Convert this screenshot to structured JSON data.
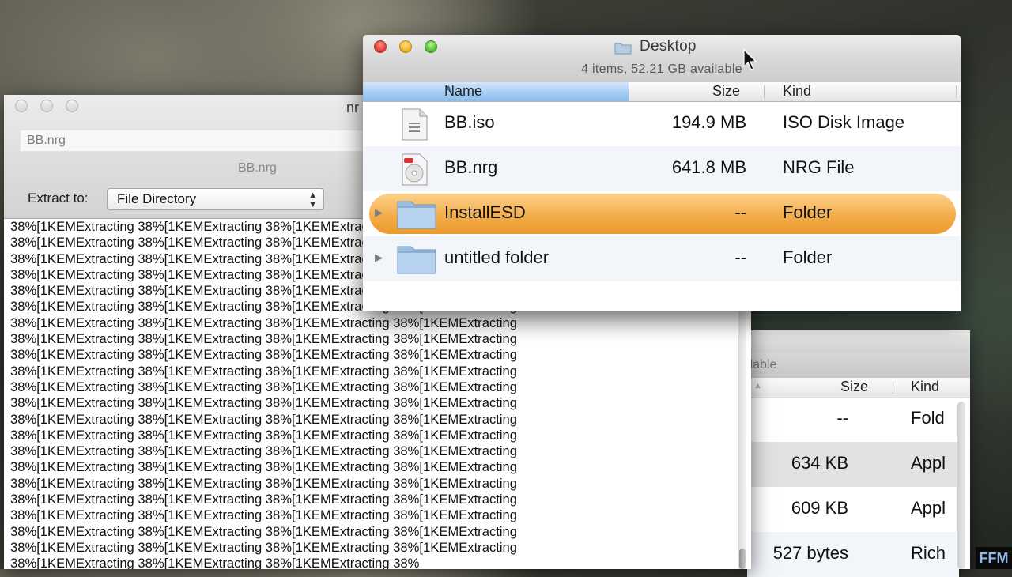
{
  "back_finder": {
    "status_fragment": "ilable",
    "columns": {
      "size": "Size",
      "kind": "Kind"
    },
    "rows": [
      {
        "size": "--",
        "kind": "Fold"
      },
      {
        "size": "634 KB",
        "kind": "Appl"
      },
      {
        "size": "609 KB",
        "kind": "Appl"
      },
      {
        "size": "527 bytes",
        "kind": "Rich"
      }
    ]
  },
  "extractor": {
    "title_fragment": "nr",
    "file_field": "BB.nrg",
    "subtitle": "BB.nrg",
    "extract_label": "Extract to:",
    "extract_option": "File Directory",
    "log_line": "38%[1KEMExtracting 38%[1KEMExtracting 38%[1KEMExtracting 38%[1KEMExtracting",
    "log_last_line": "38%[1KEMExtracting 38%[1KEMExtracting 38%[1KEMExtracting 38%"
  },
  "finder": {
    "title": "Desktop",
    "status": "4 items, 52.21 GB available",
    "columns": {
      "name": "Name",
      "size": "Size",
      "kind": "Kind"
    },
    "rows": [
      {
        "name": "BB.iso",
        "size": "194.9 MB",
        "kind": "ISO Disk Image",
        "icon": "iso-file-icon"
      },
      {
        "name": "BB.nrg",
        "size": "641.8 MB",
        "kind": "NRG File",
        "icon": "nrg-file-icon"
      },
      {
        "name": "InstallESD",
        "size": "--",
        "kind": "Folder",
        "icon": "folder-icon",
        "selected": true
      },
      {
        "name": "untitled folder",
        "size": "--",
        "kind": "Folder",
        "icon": "folder-icon"
      }
    ],
    "selection_color": "#f3aa45"
  },
  "watermark": "FFM"
}
